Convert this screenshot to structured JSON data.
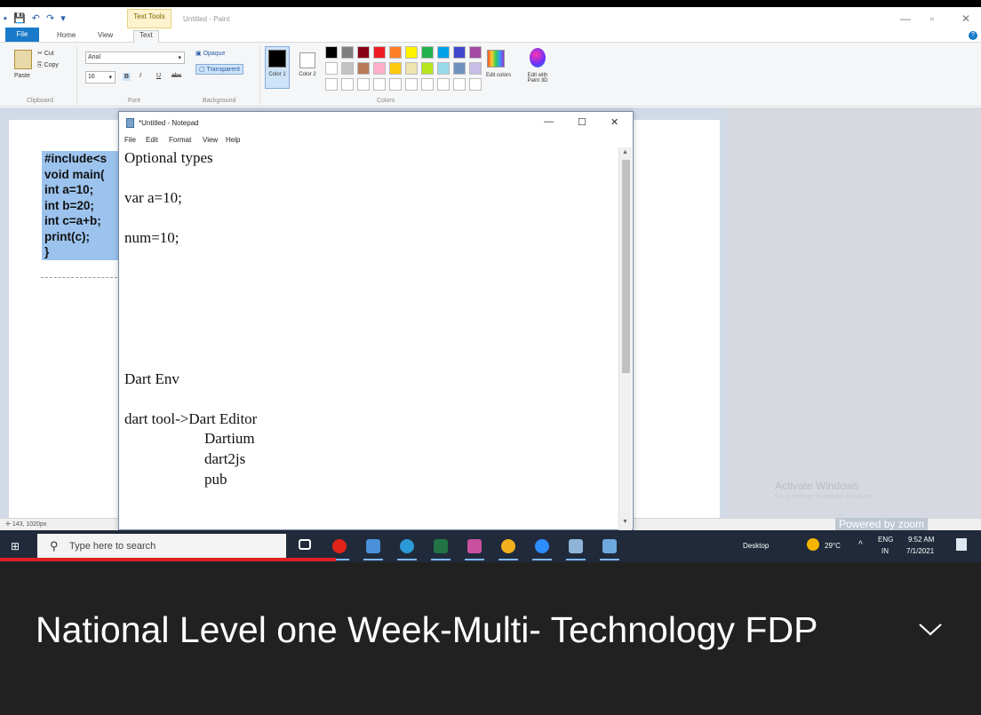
{
  "paint": {
    "doc_title": "Untitled - Paint",
    "context_tab": "Text Tools",
    "menu": {
      "file": "File",
      "home": "Home",
      "view": "View",
      "text": "Text"
    },
    "clipboard": {
      "paste": "Paste",
      "cut": "Cut",
      "copy": "Copy",
      "label": "Clipboard"
    },
    "font": {
      "family": "Arial",
      "size": "16",
      "label": "Font",
      "bold": "B",
      "italic": "I",
      "underline": "U",
      "strike": "abc"
    },
    "background": {
      "opaque": "Opaque",
      "transparent": "Transparent",
      "label": "Background"
    },
    "colors": {
      "color1": "Color 1",
      "color2": "Color 2",
      "label": "Colors",
      "edit_colors": "Edit colors",
      "edit_paint3d": "Edit with Paint 3D",
      "row1": [
        "#000000",
        "#7f7f7f",
        "#880015",
        "#ed1c24",
        "#ff7f27",
        "#fff200",
        "#22b14c",
        "#00a2e8",
        "#3f48cc",
        "#a349a4"
      ],
      "row2": [
        "#ffffff",
        "#c3c3c3",
        "#b97a57",
        "#ffaec9",
        "#ffc90e",
        "#efe4b0",
        "#b5e61d",
        "#99d9ea",
        "#7092be",
        "#c8bfe7"
      ]
    },
    "canvas_code": [
      "#include<s",
      "void main(",
      "int a=10;",
      "int b=20;",
      "int c=a+b;",
      "print(c);",
      "}"
    ],
    "status": "143, 1020px",
    "watermark_title": "Activate Windows",
    "watermark_sub": "Go to Settings to activate Windows.",
    "brand": "Powered by zoom"
  },
  "notepad": {
    "title": "*Untitled - Notepad",
    "menu": [
      "File",
      "Edit",
      "Format",
      "View",
      "Help"
    ],
    "lines": [
      {
        "text": "Optional types",
        "indent": 0,
        "row": 0
      },
      {
        "text": "var a=10;",
        "indent": 0,
        "row": 2
      },
      {
        "text": "num=10;",
        "indent": 0,
        "row": 4
      },
      {
        "text": "Dart Env",
        "indent": 0,
        "row": 11
      },
      {
        "text": "dart tool->Dart Editor",
        "indent": 0,
        "row": 13
      },
      {
        "text": "Dartium",
        "indent": 1,
        "row": 14
      },
      {
        "text": "dart2js",
        "indent": 1,
        "row": 15
      },
      {
        "text": "pub",
        "indent": 1,
        "row": 16
      }
    ]
  },
  "taskbar": {
    "search_placeholder": "Type here to search",
    "desktop_label": "Desktop",
    "temperature": "29°C",
    "lang_top": "ENG",
    "lang_bottom": "IN",
    "time": "9:52 AM",
    "date": "7/1/2021",
    "app_icons": [
      "task-view",
      "opera",
      "photos",
      "edge",
      "excel",
      "paint-3d",
      "chrome",
      "zoom",
      "paint-brush",
      "notepad"
    ],
    "video_progress": 0.342
  },
  "caption": {
    "title": "National Level one Week-Multi- Technology FDP"
  }
}
